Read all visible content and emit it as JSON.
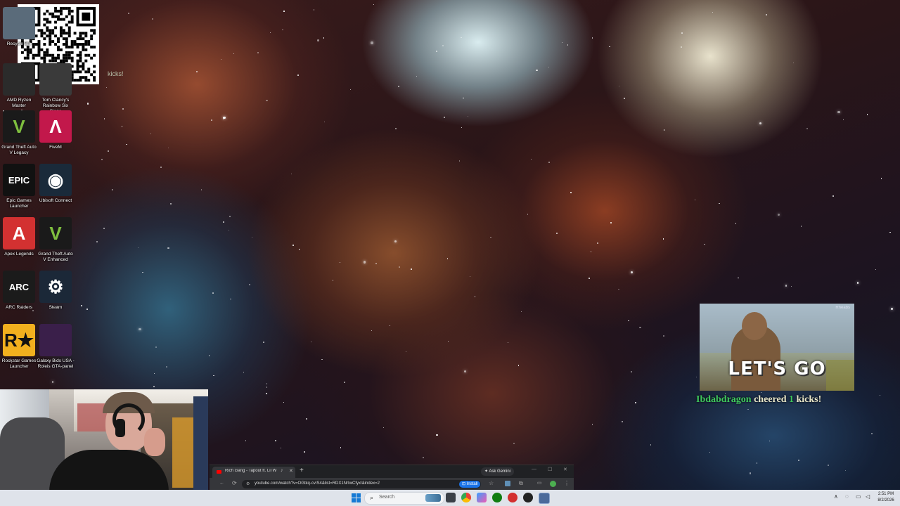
{
  "desktop": {
    "icons": [
      {
        "label": "Recycle Bin",
        "glyph": "",
        "bg": "#5a6b7a"
      },
      {
        "label": "AMD Ryzen Master",
        "glyph": "",
        "bg": "#2b2b2b"
      },
      {
        "label": "Tom Clancy's Rainbow Six Siege",
        "glyph": "",
        "bg": "#3a3a3a"
      },
      {
        "label": "Grand Theft Auto V Legacy",
        "glyph": "V",
        "bg": "#1a1a1a"
      },
      {
        "label": "FiveM",
        "glyph": "Λ",
        "bg": "#c2184b"
      },
      {
        "label": "Epic Games Launcher",
        "glyph": "EPIC",
        "bg": "#111111"
      },
      {
        "label": "Ubisoft Connect",
        "glyph": "◉",
        "bg": "#1a2a3a"
      },
      {
        "label": "Apex Legends",
        "glyph": "A",
        "bg": "#d33131"
      },
      {
        "label": "Grand Theft Auto V Enhanced",
        "glyph": "V",
        "bg": "#1a1a1a"
      },
      {
        "label": "ARC Raiders",
        "glyph": "ARC",
        "bg": "#1b1b1b"
      },
      {
        "label": "Steam",
        "glyph": "⚙",
        "bg": "#1b2838"
      },
      {
        "label": "Rockstar Games Launcher",
        "glyph": "R★",
        "bg": "#f2b01e"
      },
      {
        "label": "Galaxy Bids USA - Roleis GTA-panel",
        "glyph": "",
        "bg": "#3a1f4a"
      }
    ]
  },
  "qr_overlay": {
    "partial_text": "kicks!"
  },
  "alert": {
    "source_label": "Rheabs",
    "image_text": "LET'S GO",
    "username": "Ibdabdragon",
    "action": "cheered",
    "amount": "1",
    "unit": "kicks!"
  },
  "browser": {
    "tab_title": "Rich Gang - Tapout ft. Lil W",
    "new_tab_symbol": "+",
    "ask_gemini": "Ask Gemini",
    "url": "youtube.com/watch?v=OGtkq-cvIS4&list=RDX1NrIwCfyxI&index=2",
    "install_label": "Install",
    "colors": {
      "bg": "#1f1f22",
      "accent": "#1a73e8"
    }
  },
  "taskbar": {
    "search_placeholder": "Search",
    "time": "2:51 PM",
    "date": "8/2/2026"
  }
}
